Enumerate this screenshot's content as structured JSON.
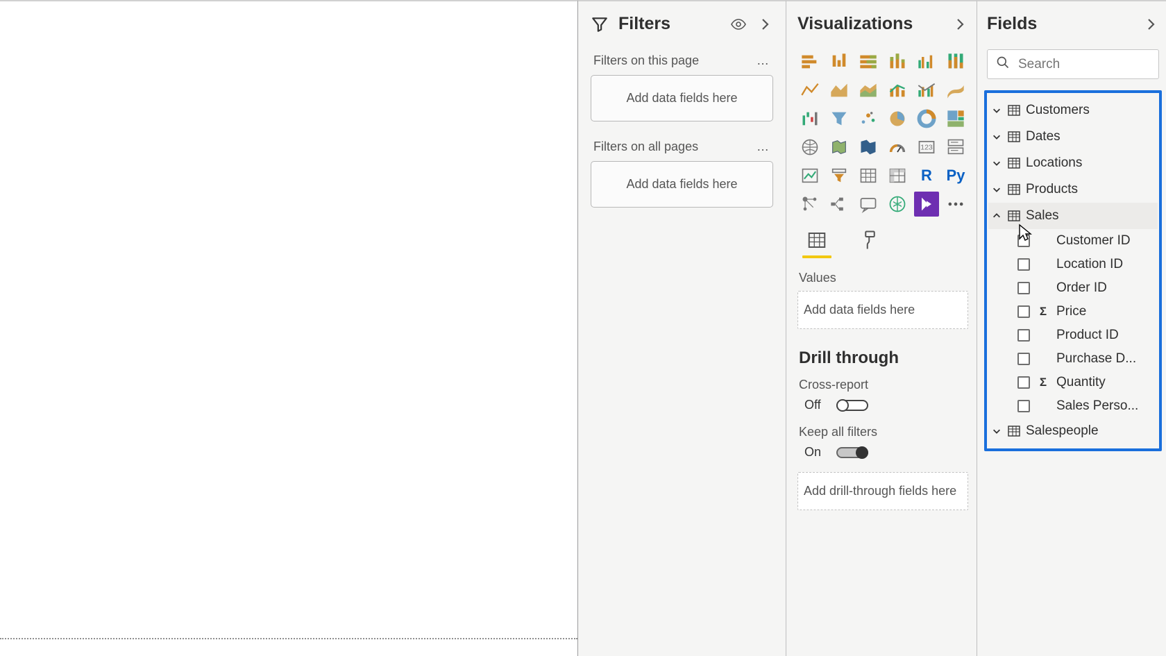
{
  "filters": {
    "title": "Filters",
    "page_label": "Filters on this page",
    "all_label": "Filters on all pages",
    "dropzone_text": "Add data fields here"
  },
  "viz": {
    "title": "Visualizations",
    "values_label": "Values",
    "values_dropzone": "Add data fields here",
    "drill_title": "Drill through",
    "cross_report_label": "Cross-report",
    "cross_report_state": "Off",
    "keep_filters_label": "Keep all filters",
    "keep_filters_state": "On",
    "drill_dropzone": "Add drill-through fields here",
    "chart_icons": [
      "stacked-bar",
      "clustered-bar",
      "stacked-bar-100",
      "stacked-column",
      "clustered-column",
      "stacked-column-100",
      "line",
      "area",
      "stacked-area",
      "line-stacked-column",
      "line-clustered-column",
      "ribbon",
      "waterfall",
      "funnel",
      "scatter",
      "pie",
      "donut",
      "treemap",
      "map",
      "filled-map",
      "shape-map",
      "gauge",
      "card",
      "multi-row-card",
      "kpi",
      "slicer",
      "table",
      "matrix",
      "r-visual",
      "python-visual",
      "key-influencers",
      "decomposition-tree",
      "qna",
      "paginated-report",
      "powerapps",
      "more-visuals"
    ]
  },
  "fields": {
    "title": "Fields",
    "search_placeholder": "Search",
    "tables": [
      {
        "name": "Customers",
        "expanded": false
      },
      {
        "name": "Dates",
        "expanded": false
      },
      {
        "name": "Locations",
        "expanded": false
      },
      {
        "name": "Products",
        "expanded": false
      },
      {
        "name": "Sales",
        "expanded": true,
        "hovered": true,
        "fields": [
          {
            "name": "Customer ID",
            "sigma": false
          },
          {
            "name": "Location ID",
            "sigma": false
          },
          {
            "name": "Order ID",
            "sigma": false
          },
          {
            "name": "Price",
            "sigma": true
          },
          {
            "name": "Product ID",
            "sigma": false
          },
          {
            "name": "Purchase D...",
            "sigma": false
          },
          {
            "name": "Quantity",
            "sigma": true
          },
          {
            "name": "Sales Perso...",
            "sigma": false
          }
        ]
      },
      {
        "name": "Salespeople",
        "expanded": false
      }
    ]
  }
}
